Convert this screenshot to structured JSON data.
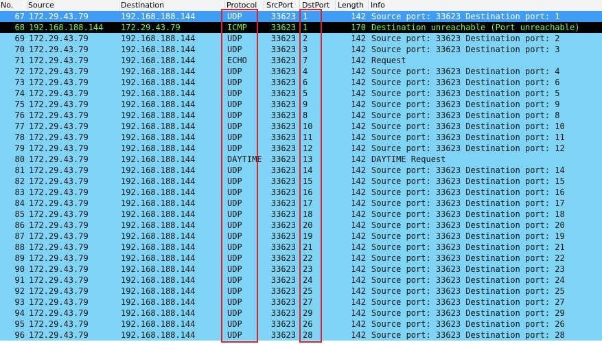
{
  "columns": [
    "No.",
    "Source",
    "Destination",
    "Protocol",
    "SrcPort",
    "DstPort",
    "Length",
    "Info"
  ],
  "packets": [
    {
      "no": "67",
      "src": "172.29.43.79",
      "dst": "192.168.188.144",
      "proto": "UDP",
      "sport": "33623",
      "dport": "1",
      "len": "142",
      "info": "Source port: 33623  Destination port: 1",
      "style": "selected"
    },
    {
      "no": "68",
      "src": "192.168.188.144",
      "dst": "172.29.43.79",
      "proto": "ICMP",
      "sport": "33623",
      "dport": "1",
      "len": "170",
      "info": "Destination unreachable (Port unreachable)",
      "style": "error"
    },
    {
      "no": "69",
      "src": "172.29.43.79",
      "dst": "192.168.188.144",
      "proto": "UDP",
      "sport": "33623",
      "dport": "2",
      "len": "142",
      "info": "Source port: 33623  Destination port: 2",
      "style": "normal"
    },
    {
      "no": "70",
      "src": "172.29.43.79",
      "dst": "192.168.188.144",
      "proto": "UDP",
      "sport": "33623",
      "dport": "3",
      "len": "142",
      "info": "Source port: 33623  Destination port: 3",
      "style": "normal"
    },
    {
      "no": "71",
      "src": "172.29.43.79",
      "dst": "192.168.188.144",
      "proto": "ECHO",
      "sport": "33623",
      "dport": "7",
      "len": "142",
      "info": "Request",
      "style": "normal"
    },
    {
      "no": "72",
      "src": "172.29.43.79",
      "dst": "192.168.188.144",
      "proto": "UDP",
      "sport": "33623",
      "dport": "4",
      "len": "142",
      "info": "Source port: 33623  Destination port: 4",
      "style": "normal"
    },
    {
      "no": "73",
      "src": "172.29.43.79",
      "dst": "192.168.188.144",
      "proto": "UDP",
      "sport": "33623",
      "dport": "6",
      "len": "142",
      "info": "Source port: 33623  Destination port: 6",
      "style": "normal"
    },
    {
      "no": "74",
      "src": "172.29.43.79",
      "dst": "192.168.188.144",
      "proto": "UDP",
      "sport": "33623",
      "dport": "5",
      "len": "142",
      "info": "Source port: 33623  Destination port: 5",
      "style": "normal"
    },
    {
      "no": "75",
      "src": "172.29.43.79",
      "dst": "192.168.188.144",
      "proto": "UDP",
      "sport": "33623",
      "dport": "9",
      "len": "142",
      "info": "Source port: 33623  Destination port: 9",
      "style": "normal"
    },
    {
      "no": "76",
      "src": "172.29.43.79",
      "dst": "192.168.188.144",
      "proto": "UDP",
      "sport": "33623",
      "dport": "8",
      "len": "142",
      "info": "Source port: 33623  Destination port: 8",
      "style": "normal"
    },
    {
      "no": "77",
      "src": "172.29.43.79",
      "dst": "192.168.188.144",
      "proto": "UDP",
      "sport": "33623",
      "dport": "10",
      "len": "142",
      "info": "Source port: 33623  Destination port: 10",
      "style": "normal"
    },
    {
      "no": "78",
      "src": "172.29.43.79",
      "dst": "192.168.188.144",
      "proto": "UDP",
      "sport": "33623",
      "dport": "11",
      "len": "142",
      "info": "Source port: 33623  Destination port: 11",
      "style": "normal"
    },
    {
      "no": "79",
      "src": "172.29.43.79",
      "dst": "192.168.188.144",
      "proto": "UDP",
      "sport": "33623",
      "dport": "12",
      "len": "142",
      "info": "Source port: 33623  Destination port: 12",
      "style": "normal"
    },
    {
      "no": "80",
      "src": "172.29.43.79",
      "dst": "192.168.188.144",
      "proto": "DAYTIME",
      "sport": "33623",
      "dport": "13",
      "len": "142",
      "info": "DAYTIME Request",
      "style": "normal"
    },
    {
      "no": "81",
      "src": "172.29.43.79",
      "dst": "192.168.188.144",
      "proto": "UDP",
      "sport": "33623",
      "dport": "14",
      "len": "142",
      "info": "Source port: 33623  Destination port: 14",
      "style": "normal"
    },
    {
      "no": "82",
      "src": "172.29.43.79",
      "dst": "192.168.188.144",
      "proto": "UDP",
      "sport": "33623",
      "dport": "15",
      "len": "142",
      "info": "Source port: 33623  Destination port: 15",
      "style": "normal"
    },
    {
      "no": "83",
      "src": "172.29.43.79",
      "dst": "192.168.188.144",
      "proto": "UDP",
      "sport": "33623",
      "dport": "16",
      "len": "142",
      "info": "Source port: 33623  Destination port: 16",
      "style": "normal"
    },
    {
      "no": "84",
      "src": "172.29.43.79",
      "dst": "192.168.188.144",
      "proto": "UDP",
      "sport": "33623",
      "dport": "17",
      "len": "142",
      "info": "Source port: 33623  Destination port: 17",
      "style": "normal"
    },
    {
      "no": "85",
      "src": "172.29.43.79",
      "dst": "192.168.188.144",
      "proto": "UDP",
      "sport": "33623",
      "dport": "18",
      "len": "142",
      "info": "Source port: 33623  Destination port: 18",
      "style": "normal"
    },
    {
      "no": "86",
      "src": "172.29.43.79",
      "dst": "192.168.188.144",
      "proto": "UDP",
      "sport": "33623",
      "dport": "20",
      "len": "142",
      "info": "Source port: 33623  Destination port: 20",
      "style": "normal"
    },
    {
      "no": "87",
      "src": "172.29.43.79",
      "dst": "192.168.188.144",
      "proto": "UDP",
      "sport": "33623",
      "dport": "19",
      "len": "142",
      "info": "Source port: 33623  Destination port: 19",
      "style": "normal"
    },
    {
      "no": "88",
      "src": "172.29.43.79",
      "dst": "192.168.188.144",
      "proto": "UDP",
      "sport": "33623",
      "dport": "21",
      "len": "142",
      "info": "Source port: 33623  Destination port: 21",
      "style": "normal"
    },
    {
      "no": "89",
      "src": "172.29.43.79",
      "dst": "192.168.188.144",
      "proto": "UDP",
      "sport": "33623",
      "dport": "22",
      "len": "142",
      "info": "Source port: 33623  Destination port: 22",
      "style": "normal"
    },
    {
      "no": "90",
      "src": "172.29.43.79",
      "dst": "192.168.188.144",
      "proto": "UDP",
      "sport": "33623",
      "dport": "23",
      "len": "142",
      "info": "Source port: 33623  Destination port: 23",
      "style": "normal"
    },
    {
      "no": "91",
      "src": "172.29.43.79",
      "dst": "192.168.188.144",
      "proto": "UDP",
      "sport": "33623",
      "dport": "24",
      "len": "142",
      "info": "Source port: 33623  Destination port: 24",
      "style": "normal"
    },
    {
      "no": "92",
      "src": "172.29.43.79",
      "dst": "192.168.188.144",
      "proto": "UDP",
      "sport": "33623",
      "dport": "25",
      "len": "142",
      "info": "Source port: 33623  Destination port: 25",
      "style": "normal"
    },
    {
      "no": "93",
      "src": "172.29.43.79",
      "dst": "192.168.188.144",
      "proto": "UDP",
      "sport": "33623",
      "dport": "27",
      "len": "142",
      "info": "Source port: 33623  Destination port: 27",
      "style": "normal"
    },
    {
      "no": "94",
      "src": "172.29.43.79",
      "dst": "192.168.188.144",
      "proto": "UDP",
      "sport": "33623",
      "dport": "29",
      "len": "142",
      "info": "Source port: 33623  Destination port: 29",
      "style": "normal"
    },
    {
      "no": "95",
      "src": "172.29.43.79",
      "dst": "192.168.188.144",
      "proto": "UDP",
      "sport": "33623",
      "dport": "26",
      "len": "142",
      "info": "Source port: 33623  Destination port: 26",
      "style": "normal"
    },
    {
      "no": "96",
      "src": "172.29.43.79",
      "dst": "192.168.188.144",
      "proto": "UDP",
      "sport": "33623",
      "dport": "28",
      "len": "142",
      "info": "Source port: 33623  Destination port: 28",
      "style": "normal"
    }
  ],
  "colors": {
    "udp_row": "#7fd4f6",
    "selected_row": "#3f9df6",
    "error_row_bg": "#000000",
    "error_row_text": "#7cfb3e",
    "highlight_box": "#e0202a"
  }
}
